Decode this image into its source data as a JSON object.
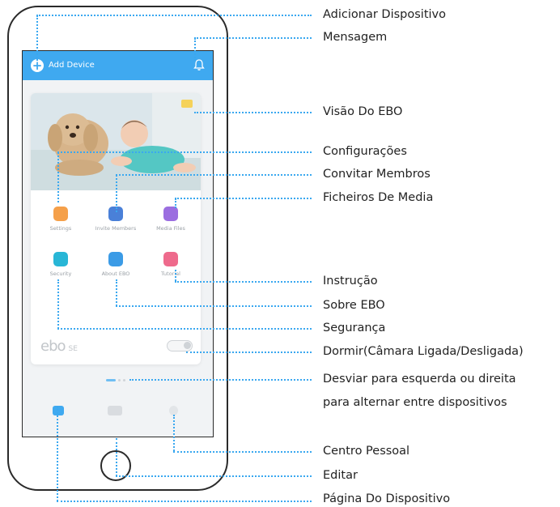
{
  "app": {
    "add_device_label": "Add Device",
    "tiles": [
      {
        "label": "Settings"
      },
      {
        "label": "Invite Members"
      },
      {
        "label": "Media Files"
      },
      {
        "label": "Security"
      },
      {
        "label": "About EBO"
      },
      {
        "label": "Tutorial"
      }
    ],
    "logo_text": "ebo",
    "logo_model": "SE"
  },
  "callouts": [
    "Adicionar Dispositivo",
    "Mensagem",
    "Visão Do EBO",
    "Configurações",
    "Convitar Membros",
    "Ficheiros De Media",
    "Instrução",
    "Sobre EBO",
    "Segurança",
    "Dormir(Câmara Ligada/Desligada)",
    "Desviar para esquerda ou direita",
    "para alternar entre dispositivos",
    "Centro Pessoal",
    "Editar",
    "Página Do Dispositivo"
  ],
  "colors": {
    "accent": "#3fa9f0",
    "callout_line": "#3aa8f0",
    "settings_icon": "#f5a04a",
    "invite_icon": "#4a80d8",
    "media_icon": "#9b6ee0",
    "security_icon": "#28b6d6",
    "about_icon": "#3b9be6",
    "tutorial_icon": "#ee6a8c"
  }
}
